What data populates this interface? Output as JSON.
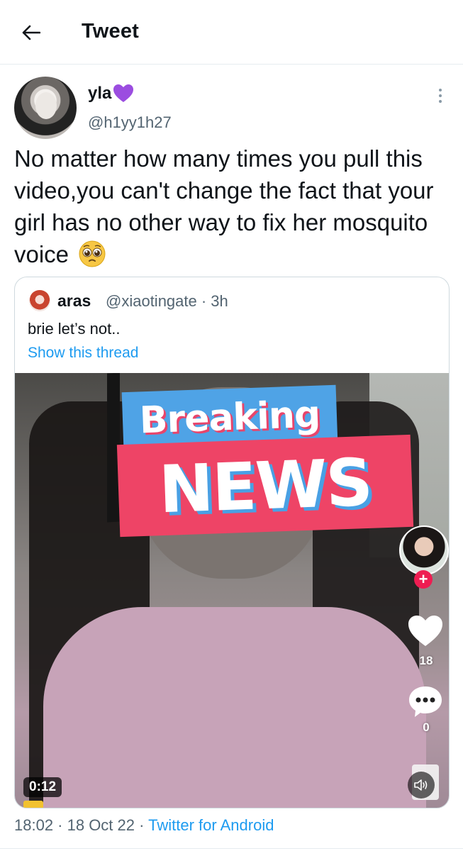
{
  "header": {
    "title": "Tweet",
    "back_icon": "arrow-left-icon"
  },
  "tweet": {
    "author_name": "yla",
    "author_emoji": "purple-heart-icon",
    "handle": "@h1yy1h27",
    "text": "No matter how many times you pull this video,you can't change the fact that your girl has no other way to fix her mosquito voice",
    "text_emoji": "pleading-face-icon",
    "more_icon": "more-vertical-icon"
  },
  "quote": {
    "author_name": "aras",
    "meta": "@xiaotingate · 3h",
    "text": "brie let’s not..",
    "show_thread": "Show this thread",
    "video": {
      "overlay_top": "Breaking",
      "overlay_bottom": "NEWS",
      "like_count": "18",
      "comment_count": "0",
      "duration": "0:12"
    }
  },
  "footer": {
    "time_date": "18:02 · 18 Oct 22 · ",
    "client": "Twitter for Android"
  },
  "colors": {
    "link": "#1d9bf0",
    "secondary_text": "#536471",
    "breaking_blue": "#4fa3e6",
    "news_red": "#ee4466"
  }
}
